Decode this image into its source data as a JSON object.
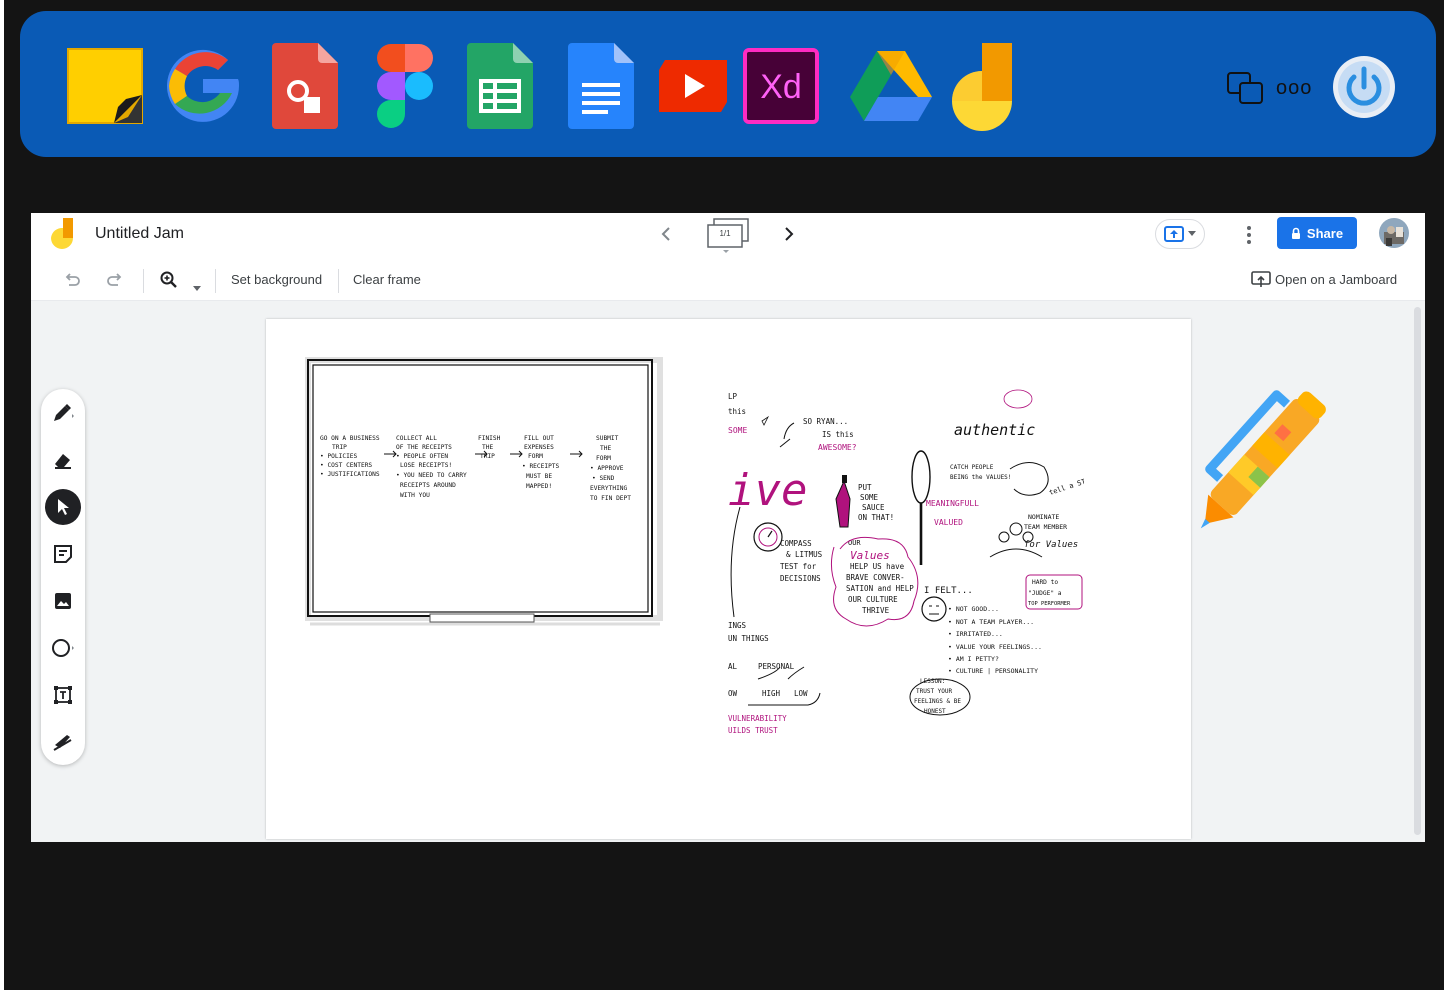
{
  "launcher": {
    "apps": [
      {
        "name": "sticky-notes"
      },
      {
        "name": "google-search"
      },
      {
        "name": "google-slides"
      },
      {
        "name": "figma"
      },
      {
        "name": "google-sheets"
      },
      {
        "name": "google-docs"
      },
      {
        "name": "youtube"
      },
      {
        "name": "adobe-xd",
        "label": "Xd"
      },
      {
        "name": "google-drive"
      },
      {
        "name": "jamboard"
      }
    ],
    "more_label": "ooo"
  },
  "jam": {
    "title": "Untitled Jam",
    "frame_indicator": "1/1",
    "share_label": "Share",
    "toolbar": {
      "set_background": "Set background",
      "clear_frame": "Clear frame",
      "open_on_jamboard": "Open on a Jamboard"
    }
  },
  "canvas": {
    "whiteboard": {
      "steps": [
        {
          "lines": [
            "GO ON A BUSINESS",
            "TRIP",
            "• POLICIES",
            "• COST CENTERS",
            "• JUSTIFICATIONS"
          ]
        },
        {
          "lines": [
            "COLLECT ALL",
            "OF THE RECEIPTS",
            "• PEOPLE OFTEN",
            "LOSE RECEIPTS!",
            "• YOU NEED TO CARRY",
            "RECEIPTS AROUND",
            "WITH YOU"
          ]
        },
        {
          "lines": [
            "FINISH",
            "THE",
            "TRIP"
          ]
        },
        {
          "lines": [
            "FILL OUT",
            "EXPENSES",
            "FORM",
            "• RECEIPTS",
            "MUST BE",
            "MAPPED!"
          ]
        },
        {
          "lines": [
            "SUBMIT",
            "THE",
            "FORM",
            "• APPROVE",
            "• SEND",
            "EVERYTHING",
            "TO FIN DEPT"
          ]
        }
      ]
    },
    "sketch": {
      "lp": "LP",
      "this": "this",
      "some": "SOME",
      "ive": "ive",
      "so_ryan": "SO RYAN...",
      "is_this": "IS this",
      "awesome": "AWESOME?",
      "authentic": "authentic",
      "catch_people": "CATCH PEOPLE",
      "being_values": "BEING the VALUES!",
      "tell_a_story": "tell a STORY",
      "put_some_sauce": [
        "PUT",
        "SOME",
        "SAUCE",
        "ON THAT!"
      ],
      "meaningfull": "MEANINGFULL",
      "valued": "VALUED",
      "nominate": [
        "NOMINATE",
        "TEAM MEMBER"
      ],
      "for_values": "for Values",
      "compass": [
        "COMPASS",
        "& LITMUS",
        "TEST for",
        "DECISIONS"
      ],
      "our_values": [
        "OUR",
        "Values"
      ],
      "help_us": [
        "HELP US have",
        "BRAVE CONVER-",
        "SATION and HELP",
        "OUR CULTURE",
        "THRIVE"
      ],
      "i_felt": "I FELT...",
      "feelings": [
        "• NOT GOOD...",
        "• NOT A TEAM PLAYER...",
        "• IRRITATED...",
        "• VALUE YOUR FEELINGS...",
        "• AM I PETTY?",
        "• CULTURE | PERSONALITY"
      ],
      "hard_to": [
        "HARD to",
        "\"JUDGE\" a",
        "TOP PERFORMER"
      ],
      "lesson": [
        "LESSON:",
        "TRUST YOUR",
        "FEELINGS & BE",
        "HONEST"
      ],
      "ings": "INGS",
      "un_things": "UN THINGS",
      "al": "AL",
      "personal": "PERSONAL",
      "ow": "OW",
      "high": "HIGH",
      "low": "LOW",
      "vulnerability": "VULNERABILITY",
      "builds_trust": "UILDS TRUST"
    }
  }
}
